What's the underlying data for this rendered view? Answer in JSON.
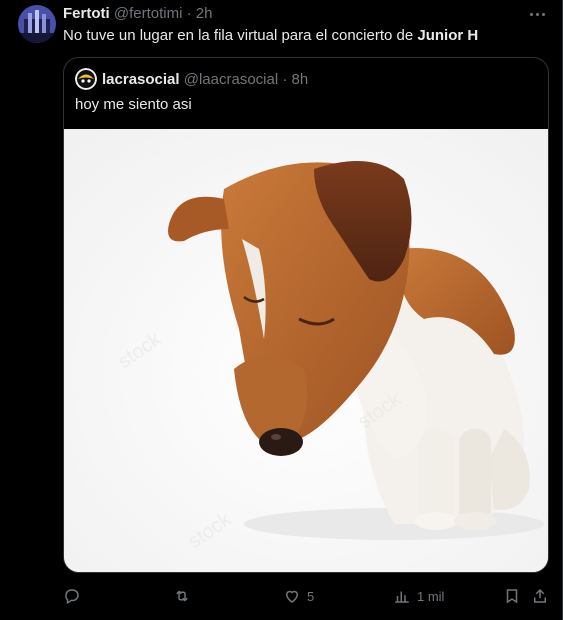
{
  "tweet": {
    "author_name": "Fertoti",
    "author_handle": "@fertotimi",
    "separator": "·",
    "time": "2h",
    "text_prefix": "No tuve un lugar en la fila virtual para el concierto de ",
    "text_bold": "Junior H"
  },
  "quoted": {
    "author_name": "lacrasocial",
    "author_handle": "@laacrasocial",
    "separator": "·",
    "time": "8h",
    "text": "hoy me siento asi",
    "image_subject": "sad-puppy-looking-down"
  },
  "actions": {
    "reply_count": "",
    "repost_count": "",
    "like_count": "5",
    "views_count": "1 mil"
  },
  "icons": [
    "more-icon",
    "reply-icon",
    "repost-icon",
    "like-icon",
    "views-icon",
    "bookmark-icon",
    "share-icon"
  ],
  "colors": {
    "background": "#000000",
    "text": "#e7e9ea",
    "muted": "#71767b",
    "border": "#2f3336"
  }
}
